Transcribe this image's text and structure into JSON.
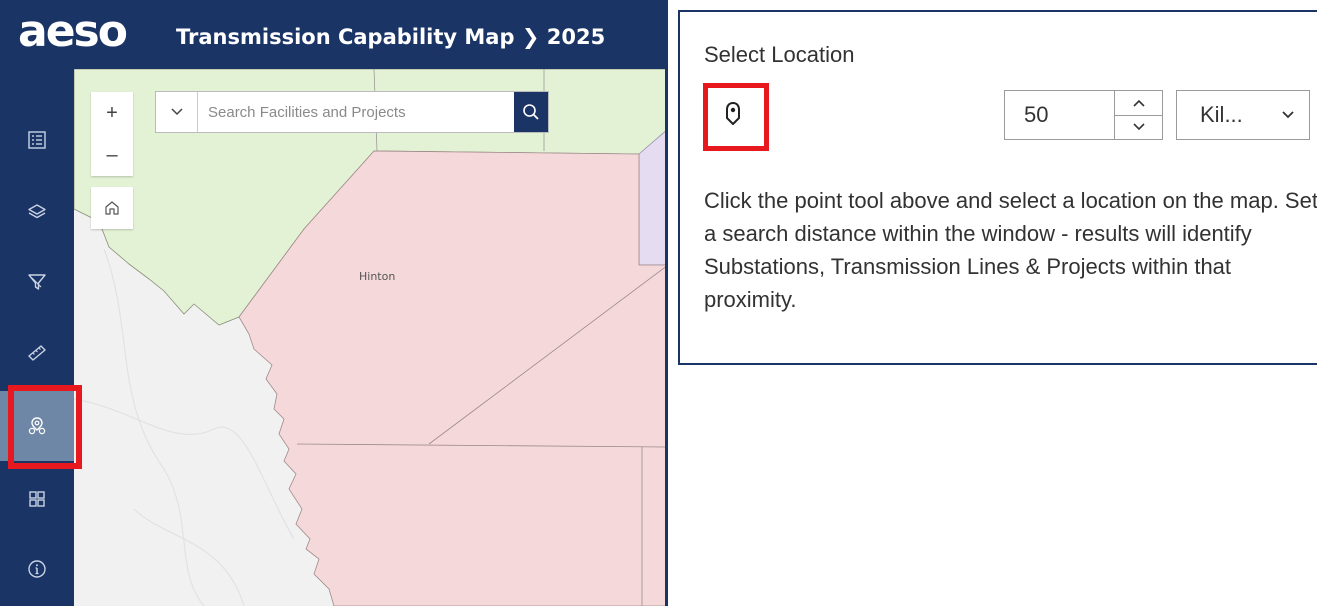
{
  "header": {
    "logo": "aeso",
    "title": "Transmission Capability Map ❯ 2025"
  },
  "sidebar": {
    "items": [
      {
        "name": "legend",
        "icon": "legend-icon"
      },
      {
        "name": "layers",
        "icon": "layers-icon"
      },
      {
        "name": "filter",
        "icon": "filter-icon"
      },
      {
        "name": "measure",
        "icon": "ruler-icon"
      },
      {
        "name": "proximity",
        "icon": "location-search-icon",
        "active": true
      },
      {
        "name": "basemap",
        "icon": "grid-icon"
      },
      {
        "name": "about",
        "icon": "info-icon"
      }
    ],
    "active_color": "#6f87a7",
    "highlight_color": "#e8191e"
  },
  "map": {
    "zoom_in": "+",
    "zoom_out": "–",
    "search_placeholder": "Search Facilities and Projects",
    "place_label": "Hinton"
  },
  "panel": {
    "title": "Select Location",
    "distance_value": "50",
    "unit": "Kil...",
    "description": "Click the point tool above and select a location on the map. Set a search distance within the window - results will identify Substations, Transmission Lines & Projects within that proximity."
  },
  "colors": {
    "brand_navy": "#1b3466",
    "region_green": "#e3f2d5",
    "region_red": "#f5d9da",
    "region_purple": "#e6dcf2"
  }
}
